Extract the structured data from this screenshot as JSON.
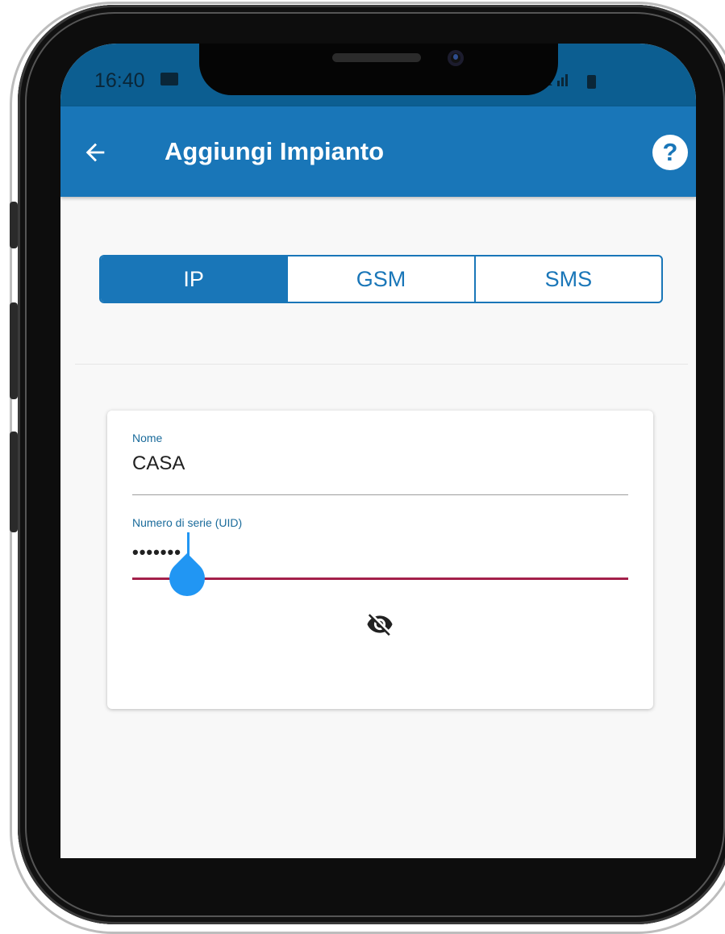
{
  "status_bar": {
    "time": "16:40"
  },
  "app_bar": {
    "title": "Aggiungi Impianto",
    "help_label": "?"
  },
  "tabs": [
    {
      "label": "IP",
      "active": true
    },
    {
      "label": "GSM",
      "active": false
    },
    {
      "label": "SMS",
      "active": false
    }
  ],
  "form": {
    "name": {
      "label": "Nome",
      "value": "CASA"
    },
    "uid": {
      "label": "Numero di serie (UID)",
      "masked_value": "•••••••"
    }
  },
  "icons": {
    "back": "arrow-left-icon",
    "help": "help-circle-icon",
    "visibility": "eye-off-icon"
  },
  "colors": {
    "primary": "#1976b8",
    "status_bar": "#0c5e91",
    "error_underline": "#a3204a",
    "cursor": "#2196f3"
  }
}
